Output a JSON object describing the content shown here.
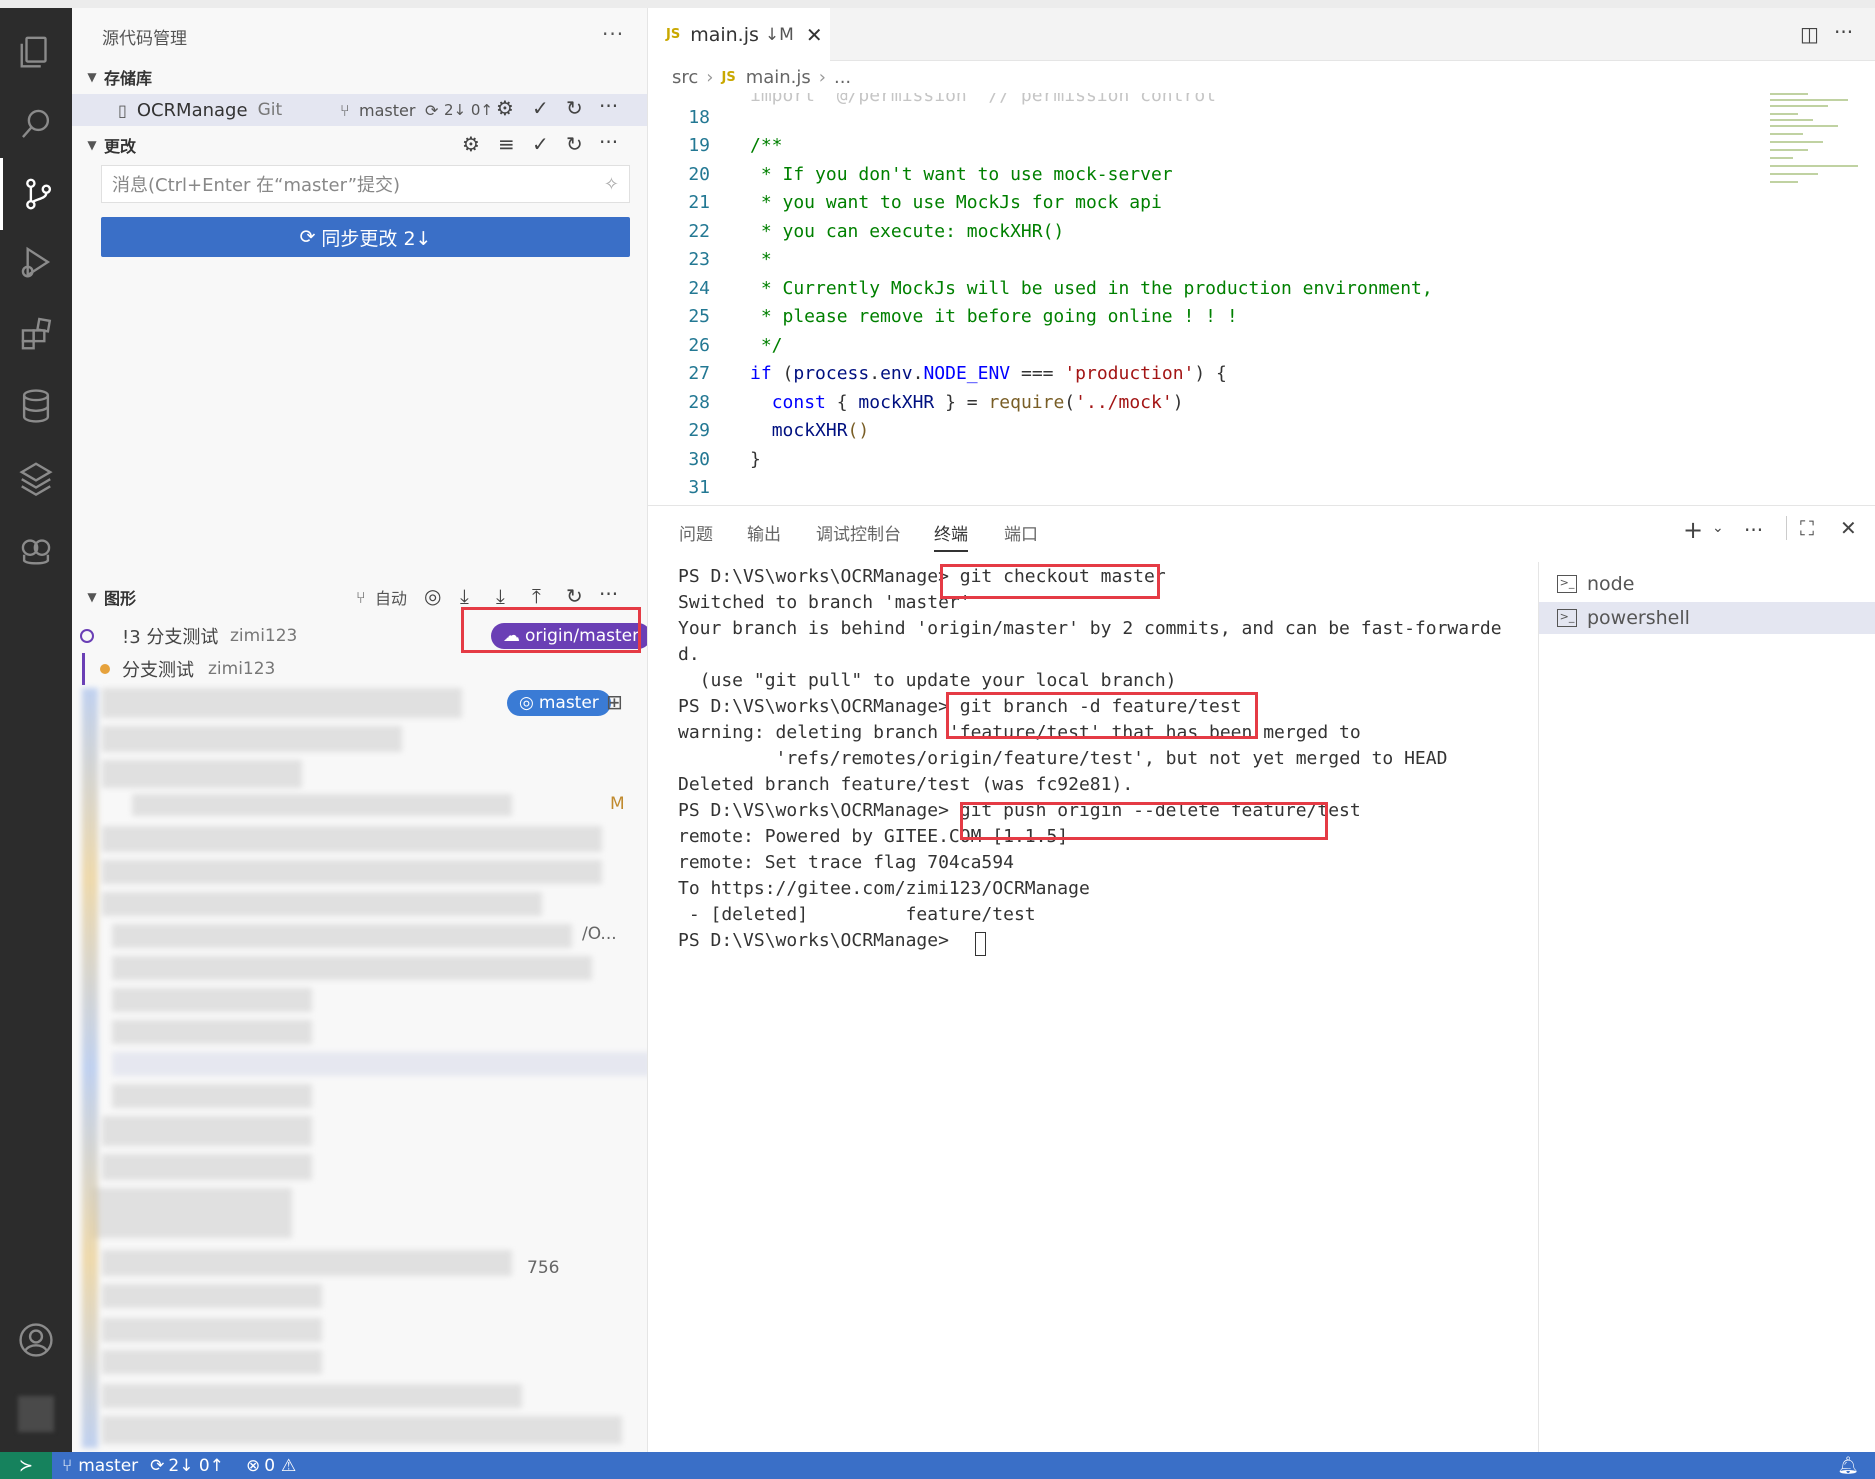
{
  "sidebar": {
    "title": "源代码管理",
    "repos_header": "存储库",
    "repo_name": "OCRManage",
    "repo_type": "Git",
    "repo_branch": "master",
    "repo_sync": "2↓ 0↑",
    "changes_header": "更改",
    "commit_placeholder": "消息(Ctrl+Enter 在“master”提交)",
    "sync_button": "同步更改 2↓",
    "graph_header": "图形",
    "graph_auto": "自动",
    "graph_commits": [
      {
        "message": "!3 分支测试",
        "author": "zimi123"
      },
      {
        "message": "分支测试",
        "author": "zimi123"
      }
    ],
    "badge_origin": "origin/master",
    "badge_master": "master",
    "fragment_m": "M",
    "fragment_o": "/O...",
    "fragment_756": "756"
  },
  "editor": {
    "tab_label": "main.js",
    "tab_status": "↓M",
    "breadcrumb": [
      "src",
      "main.js",
      "..."
    ],
    "lines": [
      {
        "n": "18",
        "t": ""
      },
      {
        "n": "19",
        "t": "/**"
      },
      {
        "n": "20",
        "t": " * If you don't want to use mock-server"
      },
      {
        "n": "21",
        "t": " * you want to use MockJs for mock api"
      },
      {
        "n": "22",
        "t": " * you can execute: mockXHR()"
      },
      {
        "n": "23",
        "t": " *"
      },
      {
        "n": "24",
        "t": " * Currently MockJs will be used in the production environment,"
      },
      {
        "n": "25",
        "t": " * please remove it before going online ! ! !"
      },
      {
        "n": "26",
        "t": " */"
      },
      {
        "n": "27",
        "t": "if (process.env.NODE_ENV === 'production') {"
      },
      {
        "n": "28",
        "t": "  const { mockXHR } = require('../mock')"
      },
      {
        "n": "29",
        "t": "  mockXHR()"
      },
      {
        "n": "30",
        "t": "}"
      },
      {
        "n": "31",
        "t": ""
      }
    ]
  },
  "panel": {
    "tabs": [
      "问题",
      "输出",
      "调试控制台",
      "终端",
      "端口"
    ],
    "active_tab": "终端",
    "terminal_lines": [
      "PS D:\\VS\\works\\OCRManage> git checkout master",
      "Switched to branch 'master'",
      "Your branch is behind 'origin/master' by 2 commits, and can be fast-forwarde",
      "d.",
      "  (use \"git pull\" to update your local branch)",
      "PS D:\\VS\\works\\OCRManage> git branch -d feature/test",
      "warning: deleting branch 'feature/test' that has been merged to",
      "         'refs/remotes/origin/feature/test', but not yet merged to HEAD",
      "Deleted branch feature/test (was fc92e81).",
      "PS D:\\VS\\works\\OCRManage> git push origin --delete feature/test",
      "remote: Powered by GITEE.COM [1.1.5]",
      "remote: Set trace flag 704ca594",
      "To https://gitee.com/zimi123/OCRManage",
      " - [deleted]         feature/test",
      "PS D:\\VS\\works\\OCRManage> "
    ],
    "terminals": [
      "node",
      "powershell"
    ]
  },
  "statusbar": {
    "branch": "master",
    "sync": "2↓ 0↑",
    "errors": "0"
  },
  "colors": {
    "accent": "#3a6fc7",
    "highlight_box": "#e53b45",
    "origin_badge": "#6a3fb5",
    "master_badge": "#3a7bd5"
  }
}
